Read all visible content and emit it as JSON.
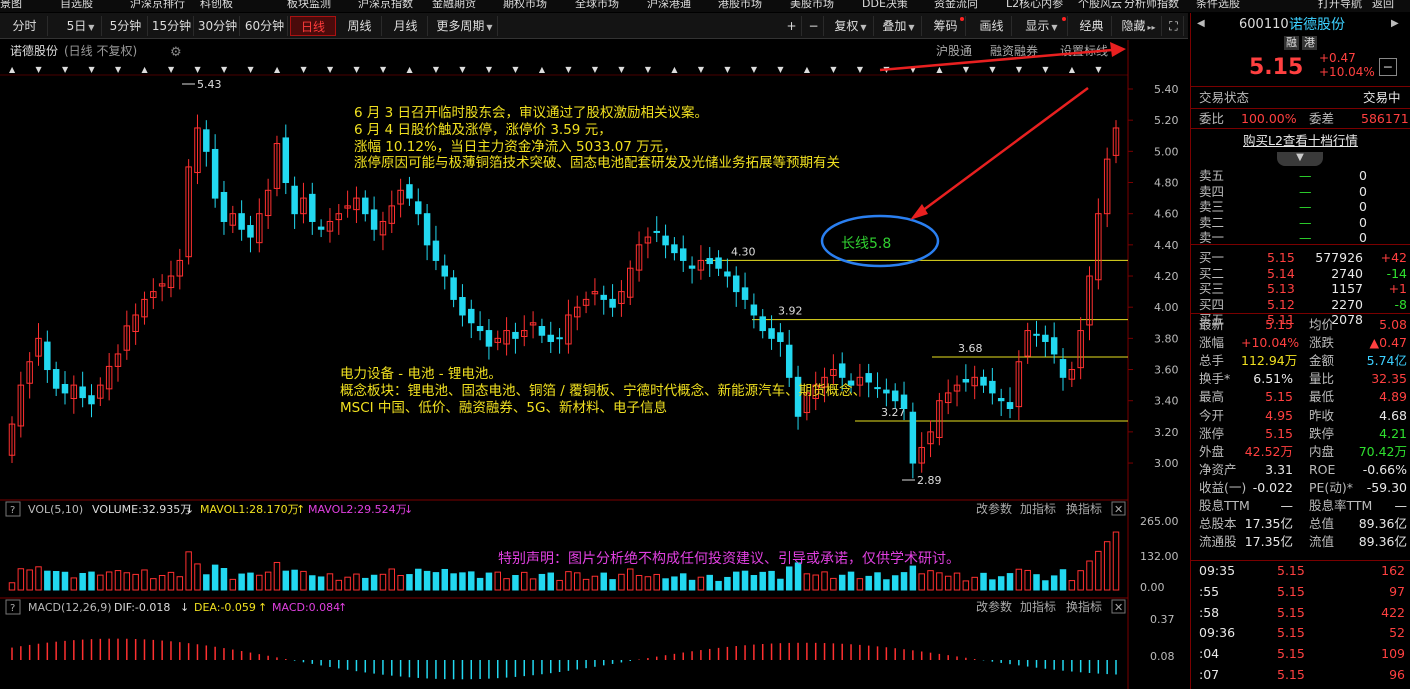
{
  "top_menu": [
    "景图",
    "自选股",
    "沪深京排行",
    "科创板",
    "板块监测",
    "沪深京指数",
    "金融期货",
    "期权市场",
    "全球市场",
    "沪深港通",
    "港股市场",
    "美股市场",
    "DDE决策",
    "资金流向",
    "L2核心内参",
    "个股风云",
    "分析师指数",
    "条件选股",
    "打开导航",
    "返回"
  ],
  "toolbar": {
    "periods": [
      "分时",
      "5日",
      "5分钟",
      "15分钟",
      "30分钟",
      "60分钟",
      "日线",
      "周线",
      "月线",
      "更多周期"
    ],
    "active": "日线",
    "right_buttons": [
      "复权",
      "叠加",
      "筹码",
      "画线",
      "显示",
      "经典",
      "隐藏"
    ],
    "plus": "+",
    "minus": "−",
    "expand": "⛶"
  },
  "chart": {
    "title": "诺德股份",
    "subtitle": "(日线 不复权)",
    "top_right_links": [
      "沪股通",
      "融资融券",
      "设置标线"
    ],
    "price_ticks": [
      "5.40",
      "5.20",
      "5.00",
      "4.80",
      "4.60",
      "4.40",
      "4.20",
      "4.00",
      "3.80",
      "3.60",
      "3.40",
      "3.20",
      "3.00"
    ],
    "high_label": "5.43",
    "low_label": "2.89",
    "levels": [
      {
        "label": "4.30",
        "value": 4.3
      },
      {
        "label": "3.92",
        "value": 3.92
      },
      {
        "label": "3.68",
        "value": 3.68
      },
      {
        "label": "3.27",
        "value": 3.27
      }
    ],
    "news_lines": [
      "6 月 3 日召开临时股东会，审议通过了股权激励相关议案。",
      "6 月 4 日股价触及涨停，涨停价 3.59 元，",
      "涨幅 10.12%，当日主力资金净流入 5033.07 万元，",
      "涨停原因可能与极薄铜箔技术突破、固态电池配套研发及光储业务拓展等预期有关"
    ],
    "concept_lines": [
      "电力设备 - 电池 - 锂电池。",
      "概念板块：锂电池、固态电池、铜箔 / 覆铜板、宁德时代概念、新能源汽车、期货概念、",
      "MSCI 中国、低价、融资融券、5G、新材料、电子信息"
    ],
    "callout": "长线5.8",
    "disclaimer": "特别声明：图片分析绝不构成任何投资建议、引导或承诺，仅供学术研讨。",
    "volume_panel": {
      "label": "VOL(5,10)",
      "volume": "VOLUME:32.935万",
      "mavol1": "MAVOL1:28.170万",
      "mavol2": "MAVOL2:29.524万",
      "ticks": [
        "265.00",
        "132.00",
        "0.00"
      ],
      "buttons": [
        "改参数",
        "加指标",
        "换指标"
      ]
    },
    "macd_panel": {
      "label": "MACD(12,26,9)",
      "dif": "DIF:-0.018",
      "dea": "DEA:-0.059",
      "macd": "MACD:0.084",
      "ticks": [
        "0.37",
        "0.08"
      ],
      "buttons": [
        "改参数",
        "加指标",
        "换指标"
      ]
    },
    "help": "?"
  },
  "chart_data": {
    "type": "candlestick",
    "title": "诺德股份 (日线 不复权)",
    "ylim": [
      2.8,
      5.5
    ],
    "y_ticks": [
      3.0,
      3.2,
      3.4,
      3.6,
      3.8,
      4.0,
      4.2,
      4.4,
      4.6,
      4.8,
      5.0,
      5.2,
      5.4
    ],
    "highest": 5.43,
    "lowest": 2.89,
    "close_series": [
      3.25,
      3.5,
      3.65,
      3.8,
      3.6,
      3.48,
      3.45,
      3.5,
      3.42,
      3.38,
      3.5,
      3.62,
      3.7,
      3.88,
      3.95,
      4.05,
      4.1,
      4.15,
      4.2,
      4.3,
      4.9,
      5.15,
      5.0,
      4.7,
      4.55,
      4.6,
      4.5,
      4.45,
      4.6,
      4.75,
      5.05,
      4.8,
      4.6,
      4.7,
      4.55,
      4.5,
      4.55,
      4.6,
      4.65,
      4.7,
      4.6,
      4.5,
      4.55,
      4.65,
      4.75,
      4.7,
      4.6,
      4.4,
      4.3,
      4.2,
      4.05,
      3.95,
      3.9,
      3.85,
      3.75,
      3.8,
      3.85,
      3.8,
      3.85,
      3.9,
      3.82,
      3.78,
      3.8,
      3.95,
      4.0,
      4.05,
      4.1,
      4.05,
      4.0,
      4.1,
      4.25,
      4.4,
      4.45,
      4.48,
      4.4,
      4.35,
      4.3,
      4.25,
      4.3,
      4.28,
      4.25,
      4.2,
      4.1,
      4.05,
      3.95,
      3.85,
      3.8,
      3.78,
      3.55,
      3.3,
      3.45,
      3.5,
      3.55,
      3.6,
      3.55,
      3.5,
      3.55,
      3.52,
      3.48,
      3.45,
      3.4,
      3.35,
      3.0,
      3.1,
      3.2,
      3.4,
      3.45,
      3.5,
      3.52,
      3.55,
      3.5,
      3.45,
      3.4,
      3.35,
      3.65,
      3.85,
      3.82,
      3.78,
      3.7,
      3.55,
      3.6,
      3.85,
      4.2,
      4.6,
      4.95,
      5.15
    ],
    "levels": [
      4.3,
      3.92,
      3.68,
      3.27
    ],
    "volume_ylim": [
      0,
      265
    ],
    "macd": {
      "dif": -0.018,
      "dea": -0.059,
      "macd": 0.084
    }
  },
  "right_panel": {
    "code": "600110",
    "name": "诺德股份",
    "tags": [
      "融",
      "港"
    ],
    "price": "5.15",
    "change": "+0.47",
    "pct": "+10.04%",
    "minus_btn": "−",
    "trade_status_label": "交易状态",
    "trade_status": "交易中",
    "webi_label": "委比",
    "webi": "100.00%",
    "weicha_label": "委差",
    "weicha": "586171",
    "l2_link": "购买L2查看十档行情",
    "asks": [
      {
        "l": "卖五",
        "p": "—",
        "v": "0"
      },
      {
        "l": "卖四",
        "p": "—",
        "v": "0"
      },
      {
        "l": "卖三",
        "p": "—",
        "v": "0"
      },
      {
        "l": "卖二",
        "p": "—",
        "v": "0"
      },
      {
        "l": "卖一",
        "p": "—",
        "v": "0"
      }
    ],
    "bids": [
      {
        "l": "买一",
        "p": "5.15",
        "v": "577926",
        "c": "+42"
      },
      {
        "l": "买二",
        "p": "5.14",
        "v": "2740",
        "c": "-14"
      },
      {
        "l": "买三",
        "p": "5.13",
        "v": "1157",
        "c": "+1"
      },
      {
        "l": "买四",
        "p": "5.12",
        "v": "2270",
        "c": "-8"
      },
      {
        "l": "买五",
        "p": "5.11",
        "v": "2078",
        "c": ""
      }
    ],
    "stats": [
      {
        "a": "最新",
        "av": "5.15",
        "ac": "red",
        "b": "均价",
        "bv": "5.08",
        "bc": "red"
      },
      {
        "a": "涨幅",
        "av": "+10.04%",
        "ac": "red",
        "b": "涨跌",
        "bv": "▲0.47",
        "bc": "red"
      },
      {
        "a": "总手",
        "av": "112.94万",
        "ac": "yel",
        "b": "金额",
        "bv": "5.74亿",
        "bc": "cyn"
      },
      {
        "a": "换手*",
        "av": "6.51%",
        "ac": "wht",
        "b": "量比",
        "bv": "32.35",
        "bc": "red"
      },
      {
        "a": "最高",
        "av": "5.15",
        "ac": "red",
        "b": "最低",
        "bv": "4.89",
        "bc": "red"
      },
      {
        "a": "今开",
        "av": "4.95",
        "ac": "red",
        "b": "昨收",
        "bv": "4.68",
        "bc": "wht"
      },
      {
        "a": "涨停",
        "av": "5.15",
        "ac": "red",
        "b": "跌停",
        "bv": "4.21",
        "bc": "grn"
      },
      {
        "a": "外盘",
        "av": "42.52万",
        "ac": "red",
        "b": "内盘",
        "bv": "70.42万",
        "bc": "grn"
      },
      {
        "a": "净资产",
        "av": "3.31",
        "ac": "wht",
        "b": "ROE",
        "bv": "-0.66%",
        "bc": "wht"
      },
      {
        "a": "收益(一)",
        "av": "-0.022",
        "ac": "wht",
        "b": "PE(动)*",
        "bv": "-59.30",
        "bc": "wht"
      },
      {
        "a": "股息TTM",
        "av": "—",
        "ac": "wht",
        "b": "股息率TTM",
        "bv": "—",
        "bc": "wht"
      },
      {
        "a": "总股本",
        "av": "17.35亿",
        "ac": "wht",
        "b": "总值",
        "bv": "89.36亿",
        "bc": "wht"
      },
      {
        "a": "流通股",
        "av": "17.35亿",
        "ac": "wht",
        "b": "流值",
        "bv": "89.36亿",
        "bc": "wht"
      }
    ],
    "ticks": [
      {
        "t": "09:35",
        "p": "5.15",
        "v": "162"
      },
      {
        "t": ":55",
        "p": "5.15",
        "v": "97"
      },
      {
        "t": ":58",
        "p": "5.15",
        "v": "422"
      },
      {
        "t": "09:36",
        "p": "5.15",
        "v": "52"
      },
      {
        "t": ":04",
        "p": "5.15",
        "v": "109"
      },
      {
        "t": ":07",
        "p": "5.15",
        "v": "96"
      }
    ]
  }
}
